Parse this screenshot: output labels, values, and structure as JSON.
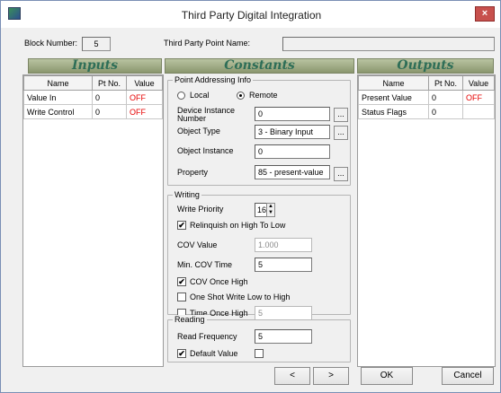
{
  "window": {
    "title": "Third Party Digital Integration",
    "close_glyph": "×"
  },
  "header": {
    "block_number_label": "Block Number:",
    "block_number_value": "5",
    "third_party_point_name_label": "Third Party Point Name:",
    "third_party_point_name_value": ""
  },
  "sections": {
    "inputs": "Inputs",
    "constants": "Constants",
    "outputs": "Outputs"
  },
  "inputs_table": {
    "columns": [
      "Name",
      "Pt No.",
      "Value"
    ],
    "rows": [
      {
        "name": "Value In",
        "pt": "0",
        "value": "OFF"
      },
      {
        "name": "Write Control",
        "pt": "0",
        "value": "OFF"
      }
    ]
  },
  "outputs_table": {
    "columns": [
      "Name",
      "Pt No.",
      "Value"
    ],
    "rows": [
      {
        "name": "Present Value",
        "pt": "0",
        "value": "OFF"
      },
      {
        "name": "Status Flags",
        "pt": "0",
        "value": ""
      }
    ]
  },
  "point_addressing": {
    "title": "Point Addressing Info",
    "local_label": "Local",
    "remote_label": "Remote",
    "selected": "remote",
    "device_instance_label": "Device Instance Number",
    "device_instance_value": "0",
    "object_type_label": "Object Type",
    "object_type_value": "3 - Binary Input",
    "object_instance_label": "Object Instance",
    "object_instance_value": "0",
    "property_label": "Property",
    "property_value": "85 - present-value",
    "browse_label": "..."
  },
  "writing": {
    "title": "Writing",
    "write_priority_label": "Write Priority",
    "write_priority_value": "16",
    "relinquish_label": "Relinquish on High To Low",
    "relinquish_checked": true,
    "cov_value_label": "COV Value",
    "cov_value": "1.000",
    "min_cov_time_label": "Min. COV Time",
    "min_cov_time_value": "5",
    "cov_once_high_label": "COV Once High",
    "cov_once_high_checked": true,
    "one_shot_label": "One Shot Write Low to High",
    "one_shot_checked": false,
    "time_once_high_label": "Time Once High",
    "time_once_high_checked": false,
    "time_once_high_value": "5"
  },
  "reading": {
    "title": "Reading",
    "read_frequency_label": "Read Frequency",
    "read_frequency_value": "5",
    "default_value_label": "Default Value",
    "default_value_checked": true,
    "default_value_box_checked": false
  },
  "footer": {
    "prev_label": "<",
    "next_label": ">",
    "ok_label": "OK",
    "cancel_label": "Cancel"
  },
  "icons": {
    "check_glyph": "✔",
    "spin_up": "▲",
    "spin_down": "▼"
  }
}
